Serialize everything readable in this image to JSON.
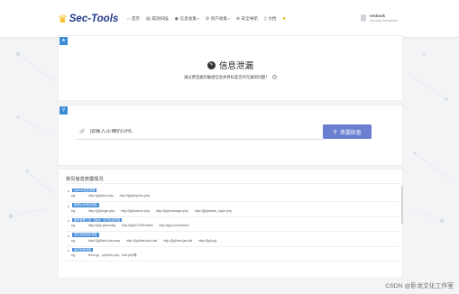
{
  "brand": {
    "name": "Sec-Tools"
  },
  "nav": [
    {
      "label": "首页",
      "icon": "home-icon",
      "glyph": "⌂",
      "caret": false
    },
    {
      "label": "漏洞扫描",
      "icon": "scan-icon",
      "glyph": "▤",
      "caret": false
    },
    {
      "label": "信息收集",
      "icon": "globe-icon",
      "glyph": "◉",
      "caret": true
    },
    {
      "label": "资产收集",
      "icon": "cog-icon",
      "glyph": "⚙",
      "caret": true
    },
    {
      "label": "安全导航",
      "icon": "compass-icon",
      "glyph": "⊕",
      "caret": false
    },
    {
      "label": "文档",
      "icon": "doc-icon",
      "glyph": "▯",
      "caret": false
    },
    {
      "label": "",
      "icon": "warning-icon",
      "glyph": "●",
      "caret": false,
      "warn": true
    }
  ],
  "user": {
    "name": "secbook",
    "role": "Security researcher"
  },
  "hero": {
    "title": "信息泄漏",
    "subtitle": "通过爬虫遍历敏感信息并目标是否存在漏洞问题！"
  },
  "search": {
    "placeholder": "请输入正确的URL",
    "button_label": "泄漏检查"
  },
  "list": {
    "title": "常见信息泄露情况",
    "items": [
      {
        "tag": "phpinfo信息泄漏",
        "eg": "eg:",
        "paths": [
          "http://[ip]/test.php",
          "http://[ip]/phpinfo.php"
        ]
      },
      {
        "tag": "管理后台地址泄露",
        "eg": "eg:",
        "paths": [
          "http://[ip]/login.php",
          "http://[ip]/admin.php",
          "http://[ip]/manager.php",
          "http://[ip]/admin_login.php"
        ]
      },
      {
        "tag": "版本管理工具（如git）文件信息泄露",
        "eg": "eg:",
        "paths": [
          "http://[ip]/.git/config",
          "http://[ip]/CVS/Entries",
          "http://[ip]/.svn/entries"
        ]
      },
      {
        "tag": "测试页面信息泄露",
        "eg": "eg:",
        "paths": [
          "http://[ip]/test.php.swp",
          "http://[ip]/test.php.bak",
          "http://[ip]/test.jsp.old",
          "http://[ip]/cgi-"
        ]
      },
      {
        "tag": "测试页面泄露",
        "eg": "eg:",
        "paths": [
          "test.cgi、phpinfo.php、info.php等"
        ]
      }
    ]
  },
  "watermark": "CSDN @卧龙文化工作室",
  "colors": {
    "accent": "#3b8bd6",
    "button": "#6b7fd1",
    "brand": "#233c8a",
    "crown": "#f4b400"
  }
}
